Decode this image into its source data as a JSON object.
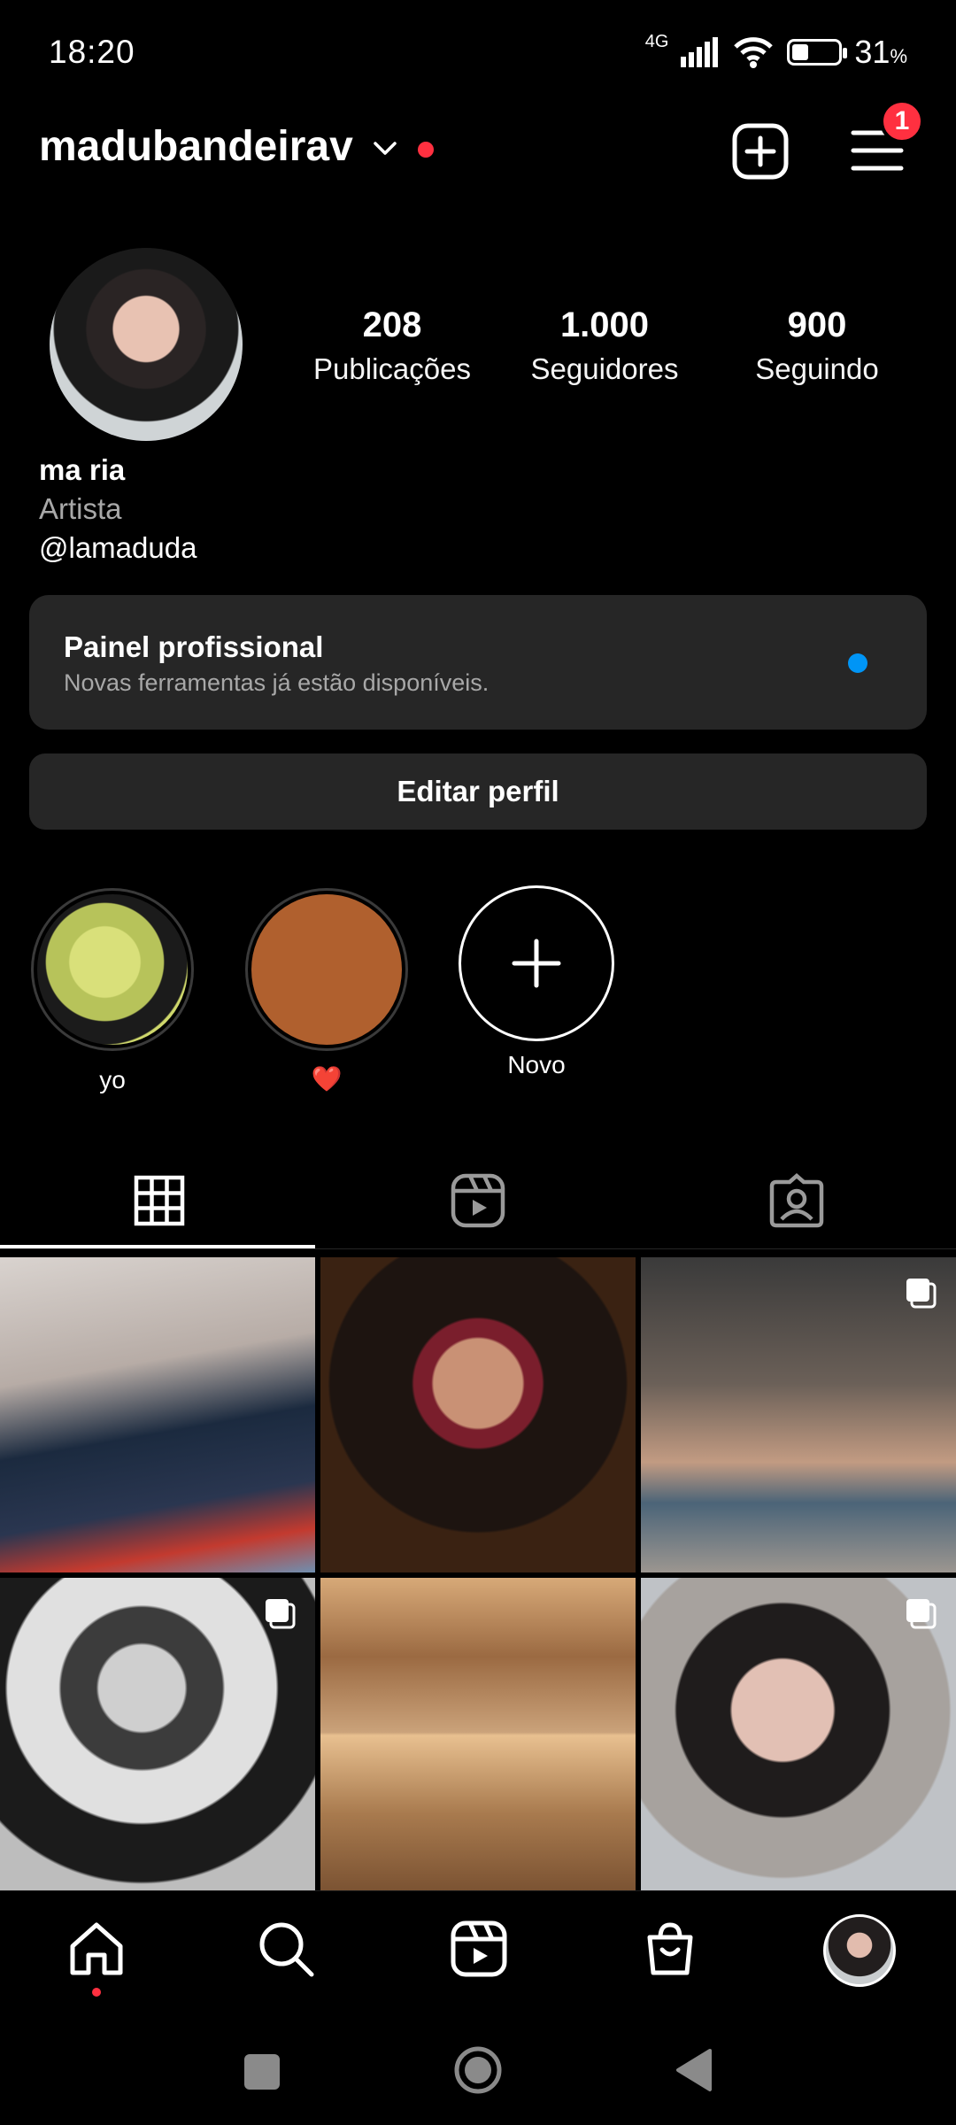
{
  "status_bar": {
    "time": "18:20",
    "network": "4G",
    "battery": "31",
    "battery_unit": "%",
    "battery_level": 0.31
  },
  "header": {
    "username": "madubandeirav",
    "menu_badge": "1"
  },
  "profile": {
    "stats": [
      {
        "value": "208",
        "label": "Publicações"
      },
      {
        "value": "1.000",
        "label": "Seguidores"
      },
      {
        "value": "900",
        "label": "Seguindo"
      }
    ],
    "name": "ma ria",
    "category": "Artista",
    "handle": "@lamaduda"
  },
  "professional_panel": {
    "title": "Painel profissional",
    "subtitle": "Novas ferramentas já estão disponíveis."
  },
  "edit_profile_label": "Editar perfil",
  "highlights": [
    {
      "label": "yo"
    },
    {
      "label": "❤️"
    },
    {
      "label": "Novo"
    }
  ],
  "tabs": [
    "grid-icon",
    "reels-icon",
    "tagged-icon"
  ],
  "colors": {
    "accent_red": "#ff3040",
    "accent_blue": "#0095f6",
    "surface": "#262626"
  }
}
